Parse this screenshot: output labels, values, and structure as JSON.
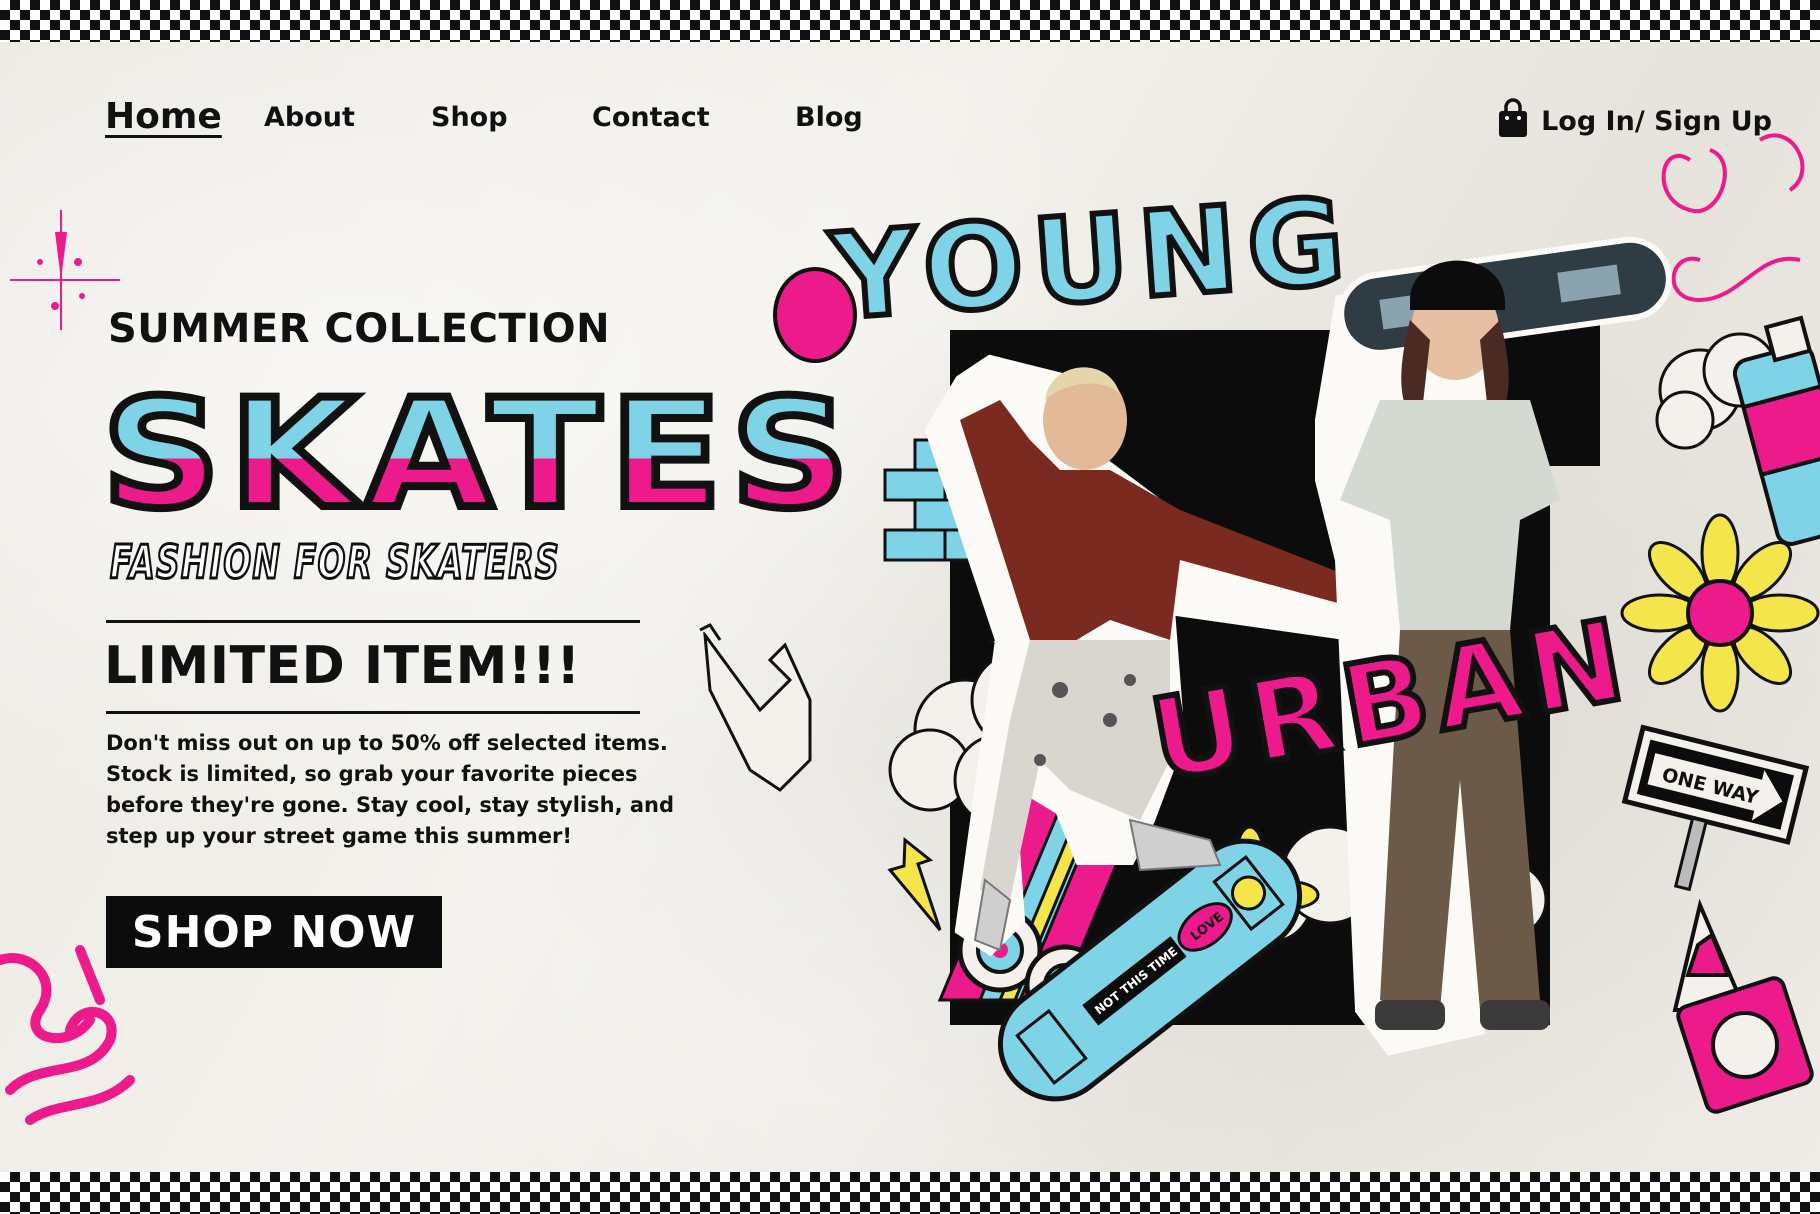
{
  "nav": {
    "home": "Home",
    "about": "About",
    "shop": "Shop",
    "contact": "Contact",
    "blog": "Blog",
    "login": "Log In/ Sign Up"
  },
  "hero": {
    "eyebrow": "SUMMER COLLECTION",
    "brand": "SKATES",
    "tagline": "FASHION FOR SKATERS",
    "headline": "LIMITED ITEM!!!",
    "body": "Don't miss out on up to 50% off selected items. Stock is limited, so grab your favorite pieces before they're gone. Stay cool, stay stylish, and step up your street game this summer!",
    "cta": "SHOP NOW"
  },
  "artwork": {
    "word_top": "YOUNG",
    "word_bottom": "URBAN",
    "sign_text": "ONE WAY",
    "deck_label": "NOT THIS TIME",
    "deck_badge": "LOVE"
  },
  "colors": {
    "pink": "#ec1a8b",
    "blue": "#7fd3e6",
    "yellow": "#f3e54a",
    "black": "#0c0c0c"
  }
}
